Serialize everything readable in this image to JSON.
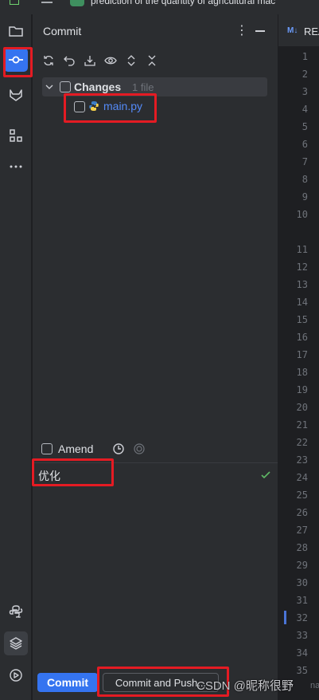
{
  "window": {
    "project_title": "prediction of the quantity of agricultural mac"
  },
  "commit_panel": {
    "title": "Commit",
    "toolbar": {
      "icons": [
        "refresh-icon",
        "rollback-icon",
        "download-icon",
        "eye-icon",
        "expand-icon",
        "collapse-icon"
      ]
    },
    "changes_label": "Changes",
    "changes_count": "1 file",
    "files": [
      {
        "name": "main.py",
        "icon": "python-icon"
      }
    ],
    "amend_label": "Amend",
    "commit_message": "优化",
    "commit_button": "Commit",
    "commit_push_button": "Commit and Push..."
  },
  "editor": {
    "tab_icon": "M↓",
    "tab_name": "REA",
    "line_numbers": [
      "1",
      "2",
      "3",
      "4",
      "5",
      "6",
      "7",
      "8",
      "9",
      "10",
      "11",
      "12",
      "13",
      "14",
      "15",
      "16",
      "17",
      "18",
      "19",
      "20",
      "21",
      "22",
      "23",
      "24",
      "25",
      "26",
      "27",
      "28",
      "29",
      "30",
      "31",
      "32",
      "33",
      "34",
      "35"
    ],
    "bottom_text": "nar"
  },
  "watermark": "CSDN @昵称很野",
  "colors": {
    "accent": "#3574f0",
    "highlight_box": "#e41b23",
    "file_name": "#548af7",
    "check": "#5fb865"
  }
}
